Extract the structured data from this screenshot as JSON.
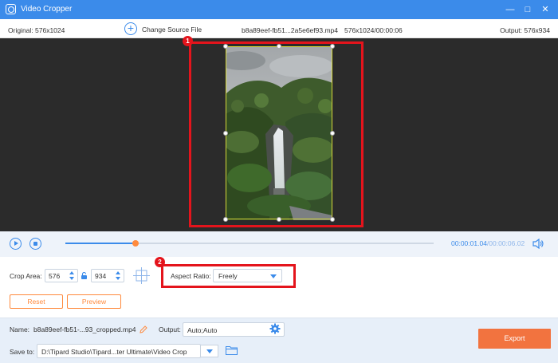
{
  "titlebar": {
    "title": "Video Cropper",
    "minimize_icon": "minimize-icon",
    "maximize_icon": "maximize-icon",
    "close_icon": "close-icon"
  },
  "infobar": {
    "original": "Original: 576x1024",
    "change_source": "Change Source File",
    "filename": "b8a89eef-fb51...2a5e6ef93.mp4",
    "meta": "576x1024/00:00:06",
    "output": "Output: 576x934"
  },
  "annotations": {
    "badge1": "1",
    "badge2": "2",
    "color": "#e4141c"
  },
  "player": {
    "current_time": "00:00:01.04",
    "total_time": "/00:00:06.02",
    "progress": 0.19
  },
  "crop": {
    "label": "Crop Area:",
    "width": "576",
    "height": "934",
    "aspect_label": "Aspect Ratio:",
    "aspect_value": "Freely",
    "reset_label": "Reset",
    "preview_label": "Preview"
  },
  "output": {
    "name_label": "Name:",
    "name_value": "b8a89eef-fb51-...93_cropped.mp4",
    "output_label": "Output:",
    "output_value": "Auto;Auto",
    "saveto_label": "Save to:",
    "saveto_value": "D:\\Tipard Studio\\Tipard...ter Ultimate\\Video Crop",
    "export_label": "Export"
  },
  "colors": {
    "accent": "#3b8bea",
    "orange": "#ff8a3d",
    "export": "#f2733f"
  }
}
